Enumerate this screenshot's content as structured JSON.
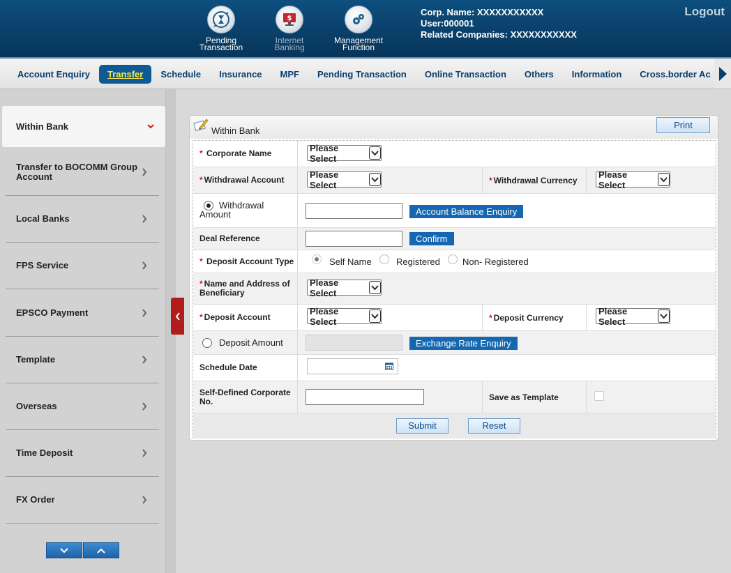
{
  "header": {
    "icons": [
      {
        "label1": "Pending",
        "label2": "Transaction",
        "icon": "hourglass-icon"
      },
      {
        "label1": "Internet",
        "label2": "Banking",
        "icon": "monitor-icon"
      },
      {
        "label1": "Management",
        "label2": "Function",
        "icon": "gears-icon"
      }
    ],
    "corp_name": "Corp. Name: XXXXXXXXXXX",
    "user": "User:000001",
    "related": "Related Companies: XXXXXXXXXXX",
    "logout": "Logout"
  },
  "nav": {
    "items": [
      "Account Enquiry",
      "Transfer",
      "Schedule",
      "Insurance",
      "MPF",
      "Pending Transaction",
      "Online Transaction",
      "Others",
      "Information",
      "Cross.border Ac"
    ],
    "active_index": 1
  },
  "sidebar": {
    "items": [
      "Within Bank",
      "Transfer to BOCOMM Group Account",
      "Local Banks",
      "FPS Service",
      "EPSCO Payment",
      "Template",
      "Overseas",
      "Time Deposit",
      "FX Order"
    ]
  },
  "panel": {
    "title": "Within Bank",
    "print": "Print",
    "corporate_name_label": "Corporate Name",
    "withdrawal_account_label": "Withdrawal Account",
    "withdrawal_currency_label": "Withdrawal Currency",
    "withdrawal_amount_label": "Withdrawal Amount",
    "account_balance_btn": "Account Balance Enquiry",
    "deal_reference_label": "Deal Reference",
    "confirm_btn": "Confirm",
    "deposit_account_type_label": "Deposit Account Type",
    "deposit_type_options": [
      "Self Name",
      "Registered",
      "Non- Registered"
    ],
    "beneficiary_label": "Name and Address of Beneficiary",
    "deposit_account_label": "Deposit Account",
    "deposit_currency_label": "Deposit Currency",
    "deposit_amount_label": "Deposit Amount",
    "exchange_rate_btn": "Exchange Rate Enquiry",
    "schedule_date_label": "Schedule Date",
    "self_defined_label": "Self-Defined Corporate No.",
    "save_template_label": "Save as Template",
    "select_placeholder": "Please Select",
    "submit": "Submit",
    "reset": "Reset"
  },
  "colors": {
    "header_bg": "#0a3f68",
    "nav_text": "#0b3e6b",
    "active_nav_bg": "#0d5a94",
    "active_nav_text": "#ffe94a",
    "action_blue": "#1467b0",
    "collapse_tab": "#b01c1c"
  }
}
